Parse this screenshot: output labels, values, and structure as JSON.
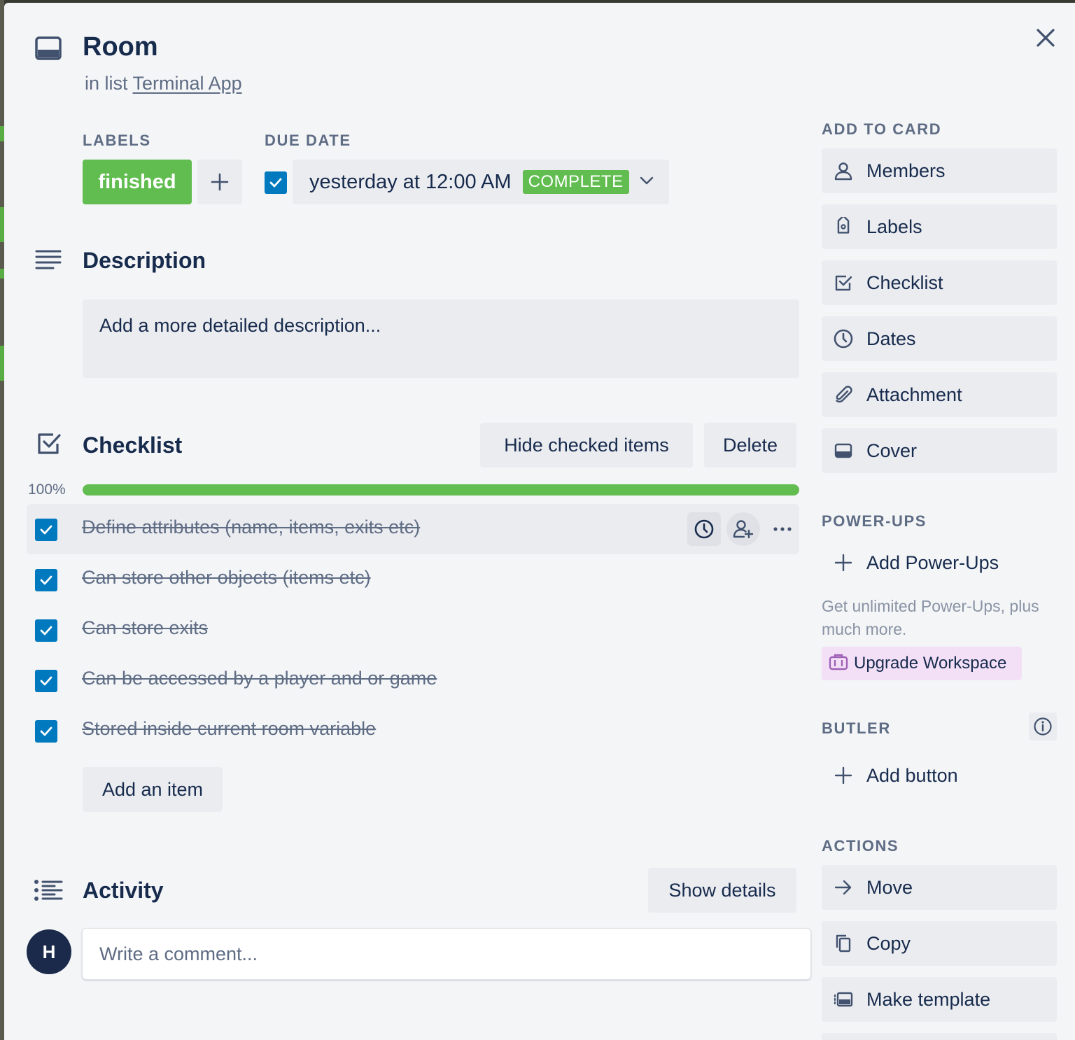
{
  "card": {
    "title": "Room",
    "in_list_prefix": "in list",
    "list_name": "Terminal App"
  },
  "labels": {
    "heading": "LABELS",
    "items": [
      "finished"
    ],
    "add_symbol": "+"
  },
  "due_date": {
    "heading": "DUE DATE",
    "checked": true,
    "text": "yesterday at 12:00 AM",
    "badge": "COMPLETE"
  },
  "description": {
    "heading": "Description",
    "placeholder": "Add a more detailed description..."
  },
  "checklist": {
    "heading": "Checklist",
    "hide_button": "Hide checked items",
    "delete_button": "Delete",
    "percent_label": "100%",
    "progress": 1.0,
    "items": [
      {
        "text": "Define attributes (name, items, exits etc)",
        "checked": true
      },
      {
        "text": "Can store other objects (items etc)",
        "checked": true
      },
      {
        "text": "Can store exits",
        "checked": true
      },
      {
        "text": "Can be accessed by a player and or game",
        "checked": true
      },
      {
        "text": "Stored inside current room variable",
        "checked": true
      }
    ],
    "add_item": "Add an item"
  },
  "activity": {
    "heading": "Activity",
    "show_details": "Show details",
    "avatar_initial": "H",
    "comment_placeholder": "Write a comment..."
  },
  "sidebar": {
    "add_to_card": {
      "heading": "ADD TO CARD",
      "items": [
        {
          "label": "Members",
          "icon": "person-icon"
        },
        {
          "label": "Labels",
          "icon": "tag-icon"
        },
        {
          "label": "Checklist",
          "icon": "checkbox-icon"
        },
        {
          "label": "Dates",
          "icon": "clock-icon"
        },
        {
          "label": "Attachment",
          "icon": "paperclip-icon"
        },
        {
          "label": "Cover",
          "icon": "card-cover-icon"
        }
      ]
    },
    "power_ups": {
      "heading": "POWER-UPS",
      "add_label": "Add Power-Ups",
      "promo": "Get unlimited Power-Ups, plus much more.",
      "upgrade_label": "Upgrade Workspace"
    },
    "butler": {
      "heading": "BUTLER",
      "add_label": "Add button"
    },
    "actions": {
      "heading": "ACTIONS",
      "items": [
        {
          "label": "Move",
          "icon": "arrow-right-icon"
        },
        {
          "label": "Copy",
          "icon": "copy-icon"
        },
        {
          "label": "Make template",
          "icon": "template-icon"
        }
      ]
    }
  },
  "colors": {
    "green": "#61bd4f",
    "blue": "#0079bf",
    "text": "#172b4d",
    "muted": "#5e6c84",
    "button_bg": "#ebecf0",
    "modal_bg": "#f4f5f7",
    "upgrade_bg": "#f3e0f7"
  }
}
